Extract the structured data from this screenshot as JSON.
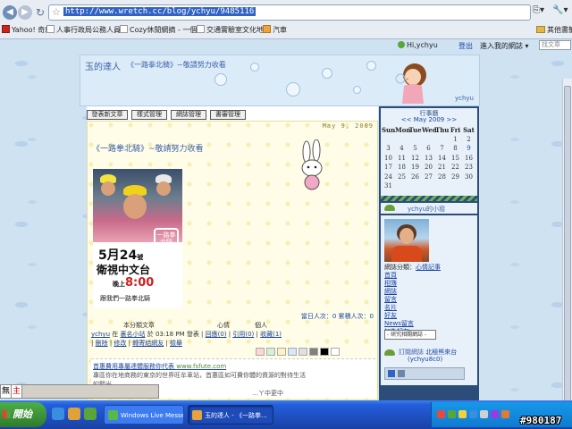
{
  "browser": {
    "url": "http://www.wretch.cc/blog/ychyu/9485116",
    "page_menu": "⎘▾",
    "tools_menu": "🔧▾",
    "bookmarks": [
      {
        "label": "Yahoo! 奇摩"
      },
      {
        "label": "人事行政局公務人員"
      },
      {
        "label": "Cozy休閒網摘 - 一個"
      },
      {
        "label": "交通實驗室文化地圖"
      },
      {
        "label": "汽車"
      }
    ],
    "other_bookmarks": "其他書籤"
  },
  "site_toolbar": {
    "hi_user": "Hi,ychyu",
    "signout": "登出",
    "mysite": "進入我的網誌 ▾",
    "search_placeholder": "找文章"
  },
  "banner": {
    "blog_title": "玉的達人",
    "blog_subtitle": "《一路拳北騎》~敬請努力收看",
    "username": "ychyu"
  },
  "manage_buttons": [
    "發表新文章",
    "樣式管理",
    "網誌管理",
    "書審管理"
  ],
  "post": {
    "date": "May 9, 2009",
    "title": "《一路拳北騎》~敬請努力收看",
    "image": {
      "logo_text": "一路拳北騎",
      "date_big": "5月24",
      "date_small": "號",
      "station": "衛視中文台",
      "time_prefix": "晚上",
      "time": "8:00",
      "tagline": "跟我們一路拳北騎"
    },
    "visit_count": "當日人次：0  累積人次：0",
    "meta_line_1": "本分類文章　　　　　　　　　　心情　　　　個人",
    "meta_author": "ychyu",
    "meta_at": "在",
    "meta_category": "裏名小站",
    "meta_time": "於 03:18 PM 發表",
    "meta_links_2": [
      "回應(0)",
      "引用(0)",
      "收藏(1)"
    ],
    "meta_links_3": [
      "刪除",
      "修改",
      "轉寄給網友",
      "檢舉"
    ],
    "swatch_colors": [
      "#ffd6d6",
      "#d6f0d6",
      "#fff2c2",
      "#d6e6ff",
      "#e0e0e0",
      "#808080",
      "#000000",
      "#ffffff"
    ],
    "ad": {
      "title": "首惠費用專屬達體服務你代表",
      "url": "www.fsfute.com",
      "desc_1": "專區你在地商務的東京的世界旺牟車站，首惠區如可費你體的資源的對待生活",
      "desc_2": "的觀光",
      "cutoff": "…ㄚ中更中"
    }
  },
  "sidebar": {
    "calendar": {
      "heading": "行事曆",
      "nav_prev": "<<",
      "month_label": "May 2009",
      "nav_next": ">>",
      "weekdays": [
        "Sun",
        "Mon",
        "Tue",
        "Wed",
        "Thu",
        "Fri",
        "Sat"
      ],
      "weeks": [
        [
          "",
          "",
          "",
          "",
          "",
          "1",
          "2"
        ],
        [
          "3",
          "4",
          "5",
          "6",
          "7",
          "8",
          "9"
        ],
        [
          "10",
          "11",
          "12",
          "13",
          "14",
          "15",
          "16"
        ],
        [
          "17",
          "18",
          "19",
          "20",
          "21",
          "22",
          "23"
        ],
        [
          "24",
          "25",
          "26",
          "27",
          "28",
          "29",
          "30"
        ],
        [
          "31",
          "",
          "",
          "",
          "",
          "",
          ""
        ]
      ],
      "linked_day": "9"
    },
    "profile_title": "ychyu的小窩",
    "profile_links": {
      "status_label": "網誌分類：",
      "status_value": "心情記事",
      "items": [
        "首頁",
        "相簿",
        "網誌",
        "留言",
        "名片",
        "好友",
        "News留言",
        "加為好友"
      ]
    },
    "related_select": "- 研究相關網誌 -",
    "subscribe_prefix": "訂閱網誌",
    "subscribe_link": "北極熊來台",
    "subscribe_sub": "(ychyu8c0)"
  },
  "ime": {
    "box1": "無",
    "box2": "主"
  },
  "taskbar": {
    "start": "開始",
    "tasks": [
      {
        "label": "Windows Live Messen..."
      },
      {
        "label": "玉的達人 - 《一路拳..."
      }
    ]
  },
  "watermark": "#980187"
}
